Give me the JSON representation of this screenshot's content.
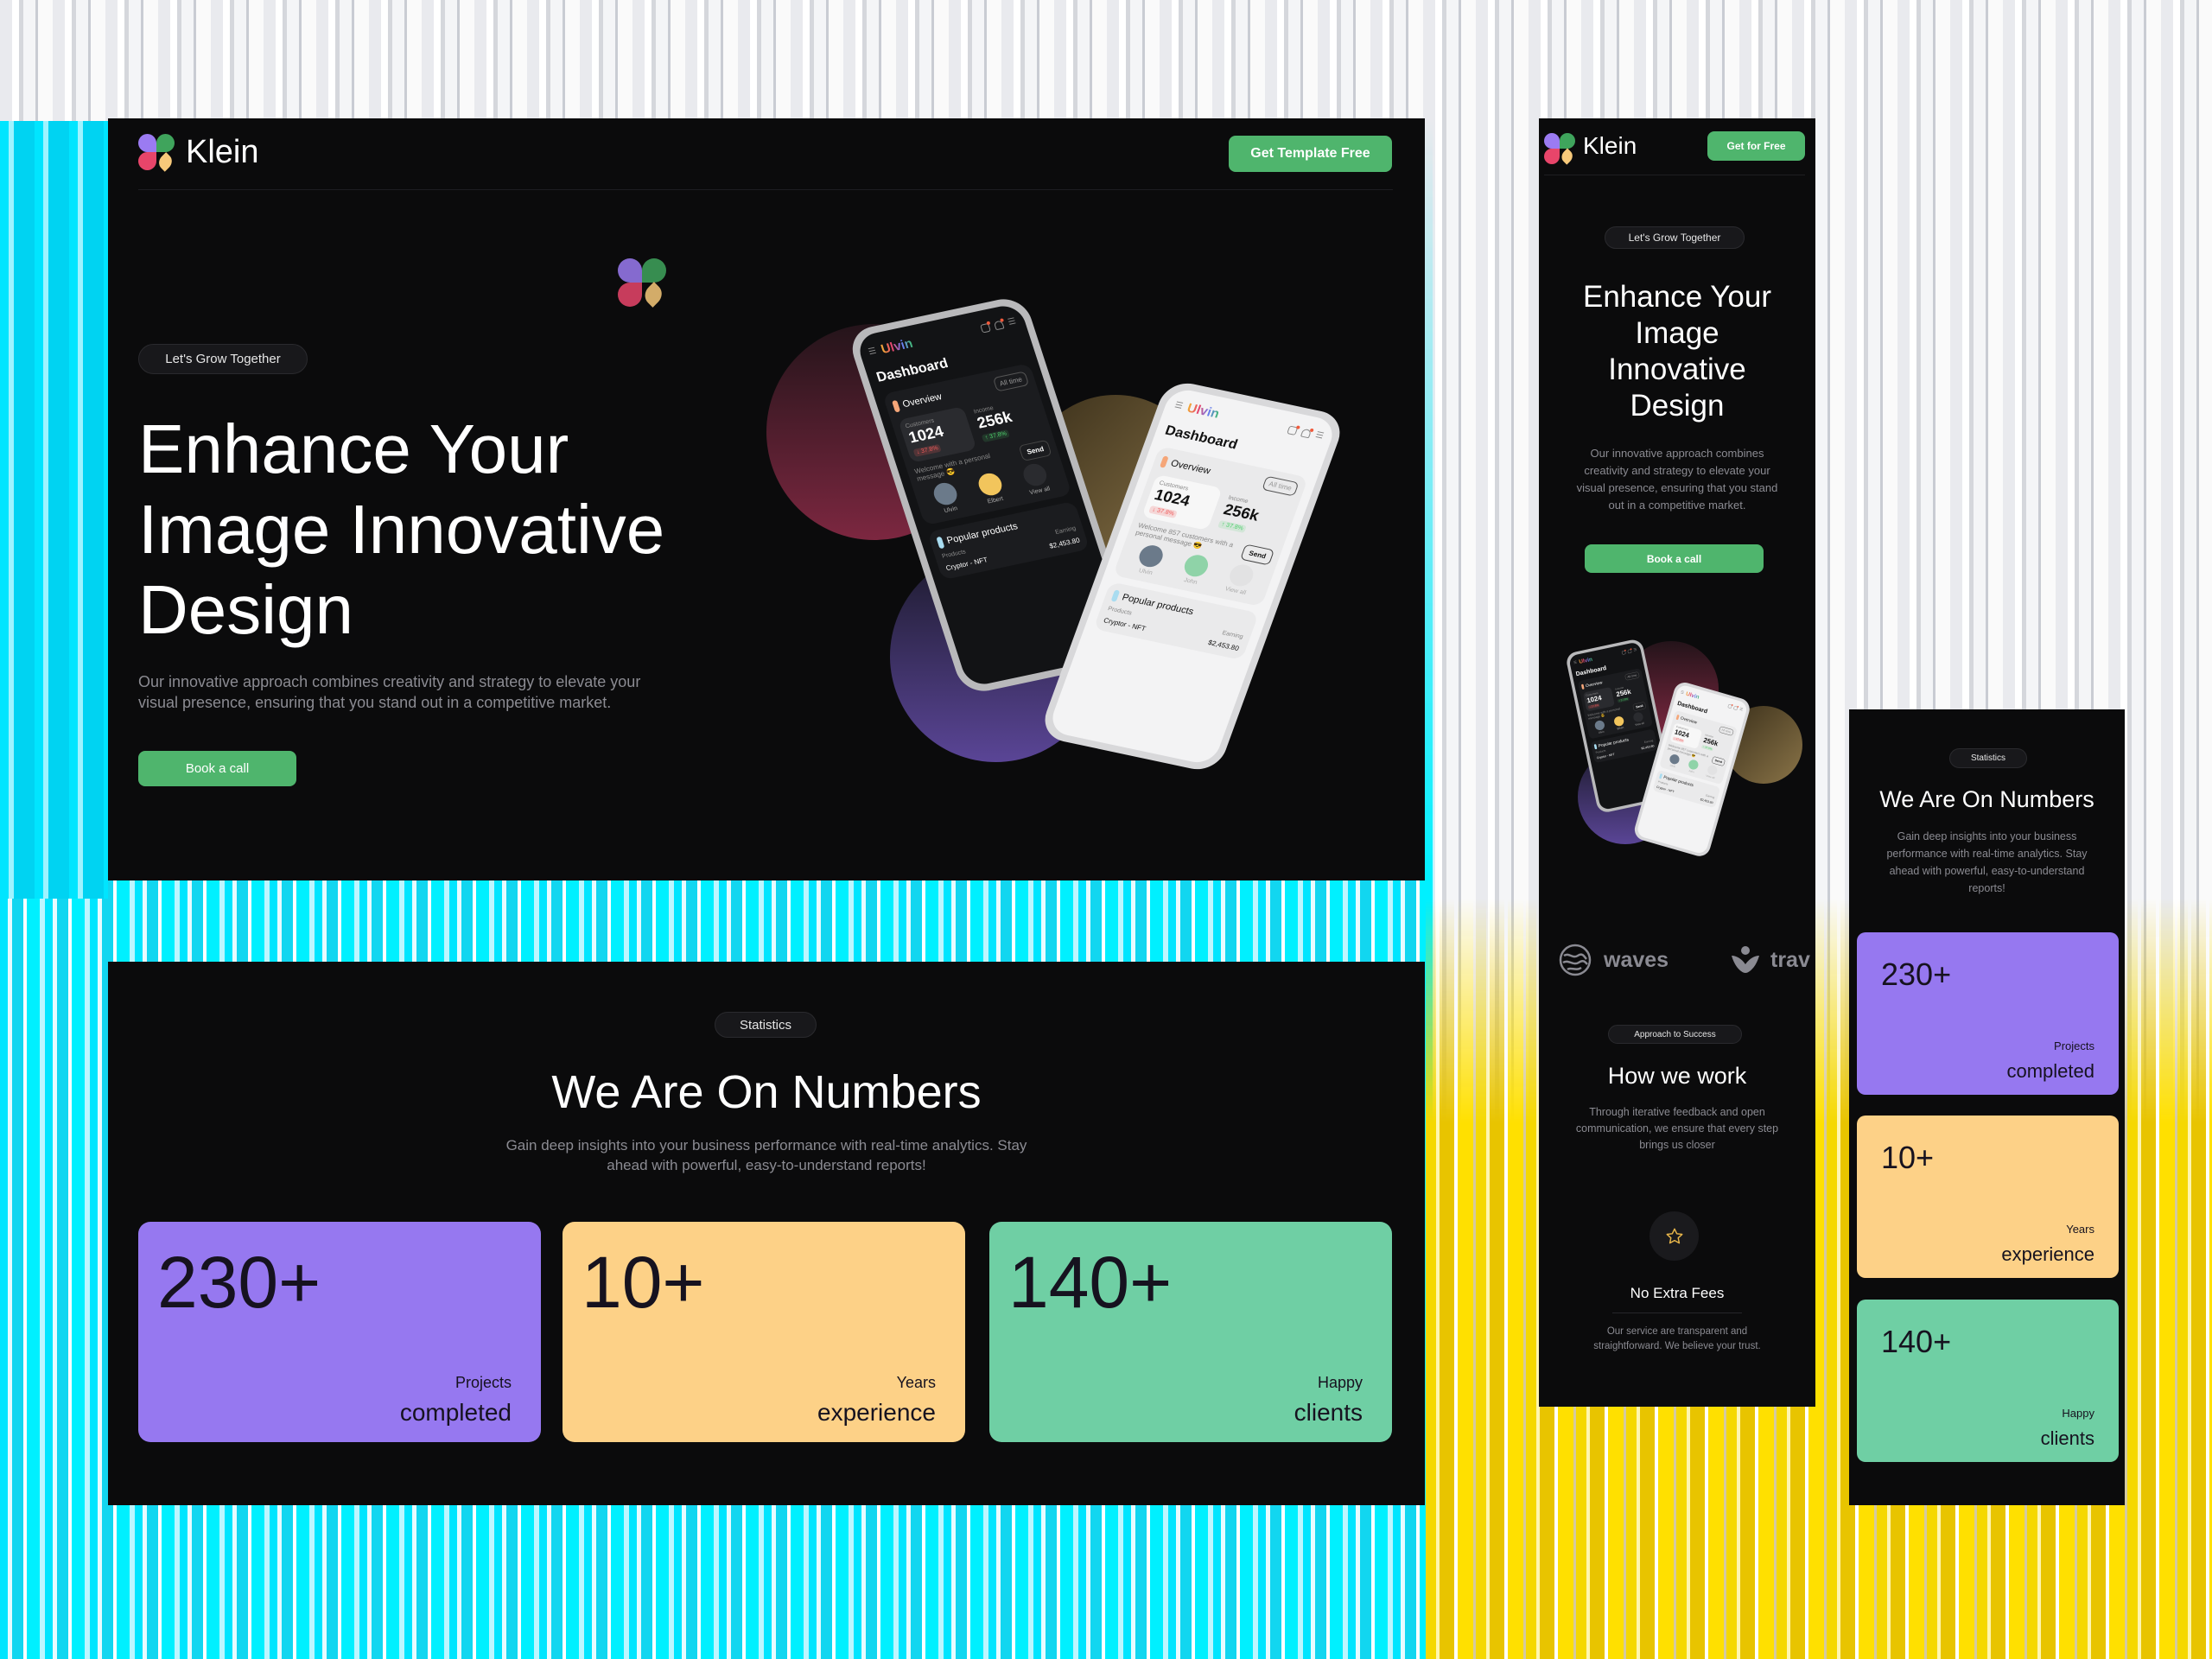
{
  "colors": {
    "accent_green": "#4fb56d",
    "card_purple": "#9678f0",
    "card_yellow": "#fdd187",
    "card_green": "#6fcfa4",
    "frame_bg": "#0b0b0c"
  },
  "brand": {
    "name": "Klein",
    "logo_icon": "four-petal-clover-logo"
  },
  "desktop": {
    "header": {
      "cta": "Get Template Free"
    },
    "hero": {
      "badge": "Let's Grow Together",
      "title_lines": [
        "Enhance Your",
        "Image Innovative",
        "Design"
      ],
      "description_lines": [
        "Our innovative approach combines creativity and strategy to elevate your",
        "visual presence, ensuring that you stand out in a competitive market."
      ],
      "cta": "Book a call"
    },
    "stats": {
      "badge": "Statistics",
      "title": "We Are On Numbers",
      "description_lines": [
        "Gain deep insights into your business performance with real-time analytics. Stay",
        "ahead with powerful, easy-to-understand reports!"
      ],
      "cards": [
        {
          "value": "230+",
          "label_top": "Projects",
          "label_bottom": "completed"
        },
        {
          "value": "10+",
          "label_top": "Years",
          "label_bottom": "experience"
        },
        {
          "value": "140+",
          "label_top": "Happy",
          "label_bottom": "clients"
        }
      ]
    }
  },
  "phones": {
    "dark": {
      "app": "Ulvin",
      "title": "Dashboard",
      "overview": "Overview",
      "range": "All time",
      "customers_label": "Customers",
      "customers": "1024",
      "customers_change": "↓ 37.8%",
      "income_label": "Income",
      "income": "256k",
      "income_change": "↑ 37.8%",
      "message": "Welcome with a personal message 😎",
      "send": "Send",
      "avatars": [
        "Ulvin",
        "Elbert",
        "View all"
      ],
      "products_title": "Popular products",
      "col_products": "Products",
      "col_earning": "Earning",
      "product": "Cryptor - NFT",
      "earning": "$2,453.80"
    },
    "light": {
      "app": "Ulvin",
      "title": "Dashboard",
      "overview": "Overview",
      "range": "All time",
      "customers_label": "Customers",
      "customers": "1024",
      "customers_change": "↓ 37.8%",
      "income_label": "Income",
      "income": "256k",
      "income_change": "↑ 37.8%",
      "message": "Welcome 857 customers with a personal message 😎",
      "send": "Send",
      "avatars": [
        "Ulvin",
        "John",
        "View all"
      ],
      "products_title": "Popular products",
      "col_products": "Products",
      "col_earning": "Earning",
      "product": "Cryptor - NFT",
      "earning": "$2,453.80"
    }
  },
  "mobile_hero": {
    "header": {
      "cta": "Get for Free"
    },
    "badge": "Let's Grow Together",
    "title_lines": [
      "Enhance Your",
      "Image",
      "Innovative",
      "Design"
    ],
    "description_lines": [
      "Our innovative approach combines",
      "creativity and strategy to elevate your",
      "visual presence, ensuring that you stand",
      "out in a competitive market."
    ],
    "cta": "Book a call",
    "partners": [
      {
        "name": "waves",
        "icon": "waves-globe-icon"
      },
      {
        "name": "trav",
        "icon": "person-leaf-icon"
      }
    ],
    "process": {
      "badge": "Approach to Success",
      "title": "How we work",
      "description_lines": [
        "Through iterative feedback and open",
        "communication, we ensure that every step",
        "brings us closer"
      ],
      "feature": {
        "icon": "star-icon",
        "title": "No Extra Fees",
        "description_lines": [
          "Our service are transparent and",
          "straightforward. We believe your trust."
        ]
      }
    }
  },
  "mobile_stats": {
    "badge": "Statistics",
    "title": "We Are On Numbers",
    "description_lines": [
      "Gain deep insights into your business",
      "performance with real-time analytics. Stay",
      "ahead with powerful, easy-to-understand",
      "reports!"
    ],
    "cards": [
      {
        "value": "230+",
        "label_top": "Projects",
        "label_bottom": "completed"
      },
      {
        "value": "10+",
        "label_top": "Years",
        "label_bottom": "experience"
      },
      {
        "value": "140+",
        "label_top": "Happy",
        "label_bottom": "clients"
      }
    ]
  }
}
